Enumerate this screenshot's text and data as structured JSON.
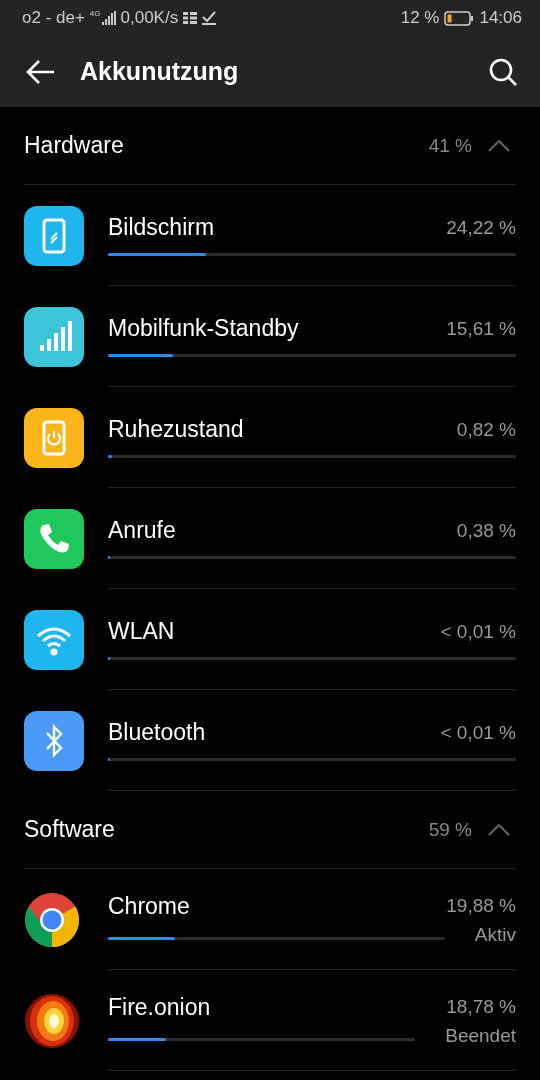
{
  "status_bar": {
    "carrier": "o2 - de+",
    "network": "4G",
    "speed": "0,00K/s",
    "battery_text": "12 %",
    "time": "14:06"
  },
  "app_bar": {
    "title": "Akkunutzung"
  },
  "sections": [
    {
      "title": "Hardware",
      "total": "41 %",
      "expanded": true,
      "items": [
        {
          "name": "Bildschirm",
          "value": "24,22 %",
          "level": 0.24,
          "kind": "screen",
          "color": "#1fb6ee"
        },
        {
          "name": "Mobilfunk-Standby",
          "value": "15,61 %",
          "level": 0.16,
          "kind": "signal",
          "color": "#3cc5d8"
        },
        {
          "name": "Ruhezustand",
          "value": "0,82 %",
          "level": 0.01,
          "kind": "sleep",
          "color": "#fbb41a"
        },
        {
          "name": "Anrufe",
          "value": "0,38 %",
          "level": 0.005,
          "kind": "phone",
          "color": "#1fc85a"
        },
        {
          "name": "WLAN",
          "value": "< 0,01 %",
          "level": 0,
          "kind": "wifi",
          "color": "#1fb6ee"
        },
        {
          "name": "Bluetooth",
          "value": "< 0,01 %",
          "level": 0,
          "kind": "bluetooth",
          "color": "#4a9bf5"
        }
      ]
    },
    {
      "title": "Software",
      "total": "59 %",
      "expanded": true,
      "items": [
        {
          "name": "Chrome",
          "value": "19,88 %",
          "level": 0.2,
          "kind": "chrome",
          "status": "Aktiv"
        },
        {
          "name": "Fire.onion",
          "value": "18,78 %",
          "level": 0.19,
          "kind": "fire",
          "status": "Beendet"
        }
      ]
    }
  ]
}
